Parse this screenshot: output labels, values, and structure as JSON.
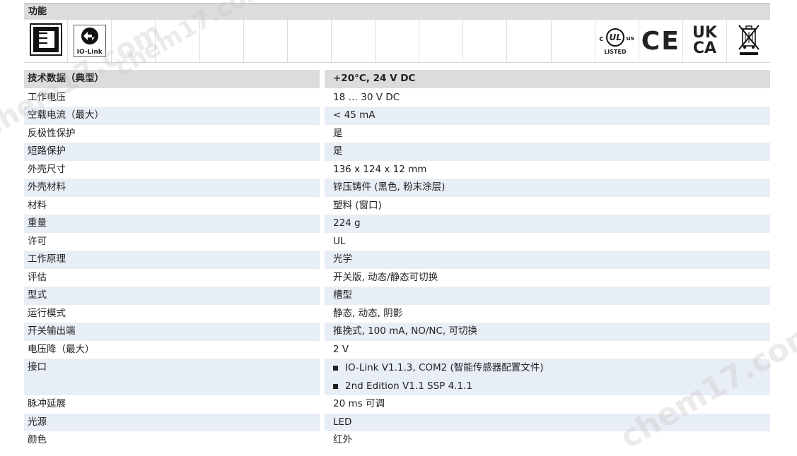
{
  "function": {
    "title": "功能",
    "io_link_label": "IO-Link",
    "ul_text": "UL",
    "ul_c": "c",
    "ul_us": "us",
    "ul_listed": "LISTED",
    "ce_text": "CE",
    "ukca_top": "UK",
    "ukca_bottom": "CA"
  },
  "table": {
    "header_key": "技术数据（典型）",
    "header_value": "+20°C, 24 V DC",
    "rows": [
      {
        "k": "工作电压",
        "v": "18 … 30 V DC"
      },
      {
        "k": "空载电流（最大）",
        "v": "< 45 mA"
      },
      {
        "k": "反极性保护",
        "v": "是"
      },
      {
        "k": "短路保护",
        "v": "是"
      },
      {
        "k": "外壳尺寸",
        "v": "136 x 124 x 12 mm"
      },
      {
        "k": "外壳材料",
        "v": "锌压铸件 (黑色, 粉末涂层)"
      },
      {
        "k": "材料",
        "v": "塑料 (窗口)"
      },
      {
        "k": "重量",
        "v": "224 g"
      },
      {
        "k": "许可",
        "v": "UL"
      },
      {
        "k": "工作原理",
        "v": "光学"
      },
      {
        "k": "评估",
        "v": "开关版, 动态/静态可切换"
      },
      {
        "k": "型式",
        "v": "槽型"
      },
      {
        "k": "运行模式",
        "v": "静态, 动态, 阴影"
      },
      {
        "k": "开关输出端",
        "v": "推挽式, 100 mA, NO/NC, 可切换"
      },
      {
        "k": "电压降（最大）",
        "v": "2 V"
      }
    ],
    "interface_key": "接口",
    "interface_items": [
      "IO-Link V1.1.3, COM2 (智能传感器配置文件)",
      "2nd Edition V1.1 SSP 4.1.1"
    ],
    "rows2": [
      {
        "k": "脉冲延展",
        "v": "20 ms 可调"
      },
      {
        "k": "光源",
        "v": "LED"
      },
      {
        "k": "颜色",
        "v": "红外"
      }
    ]
  },
  "watermark": "chem17.com"
}
